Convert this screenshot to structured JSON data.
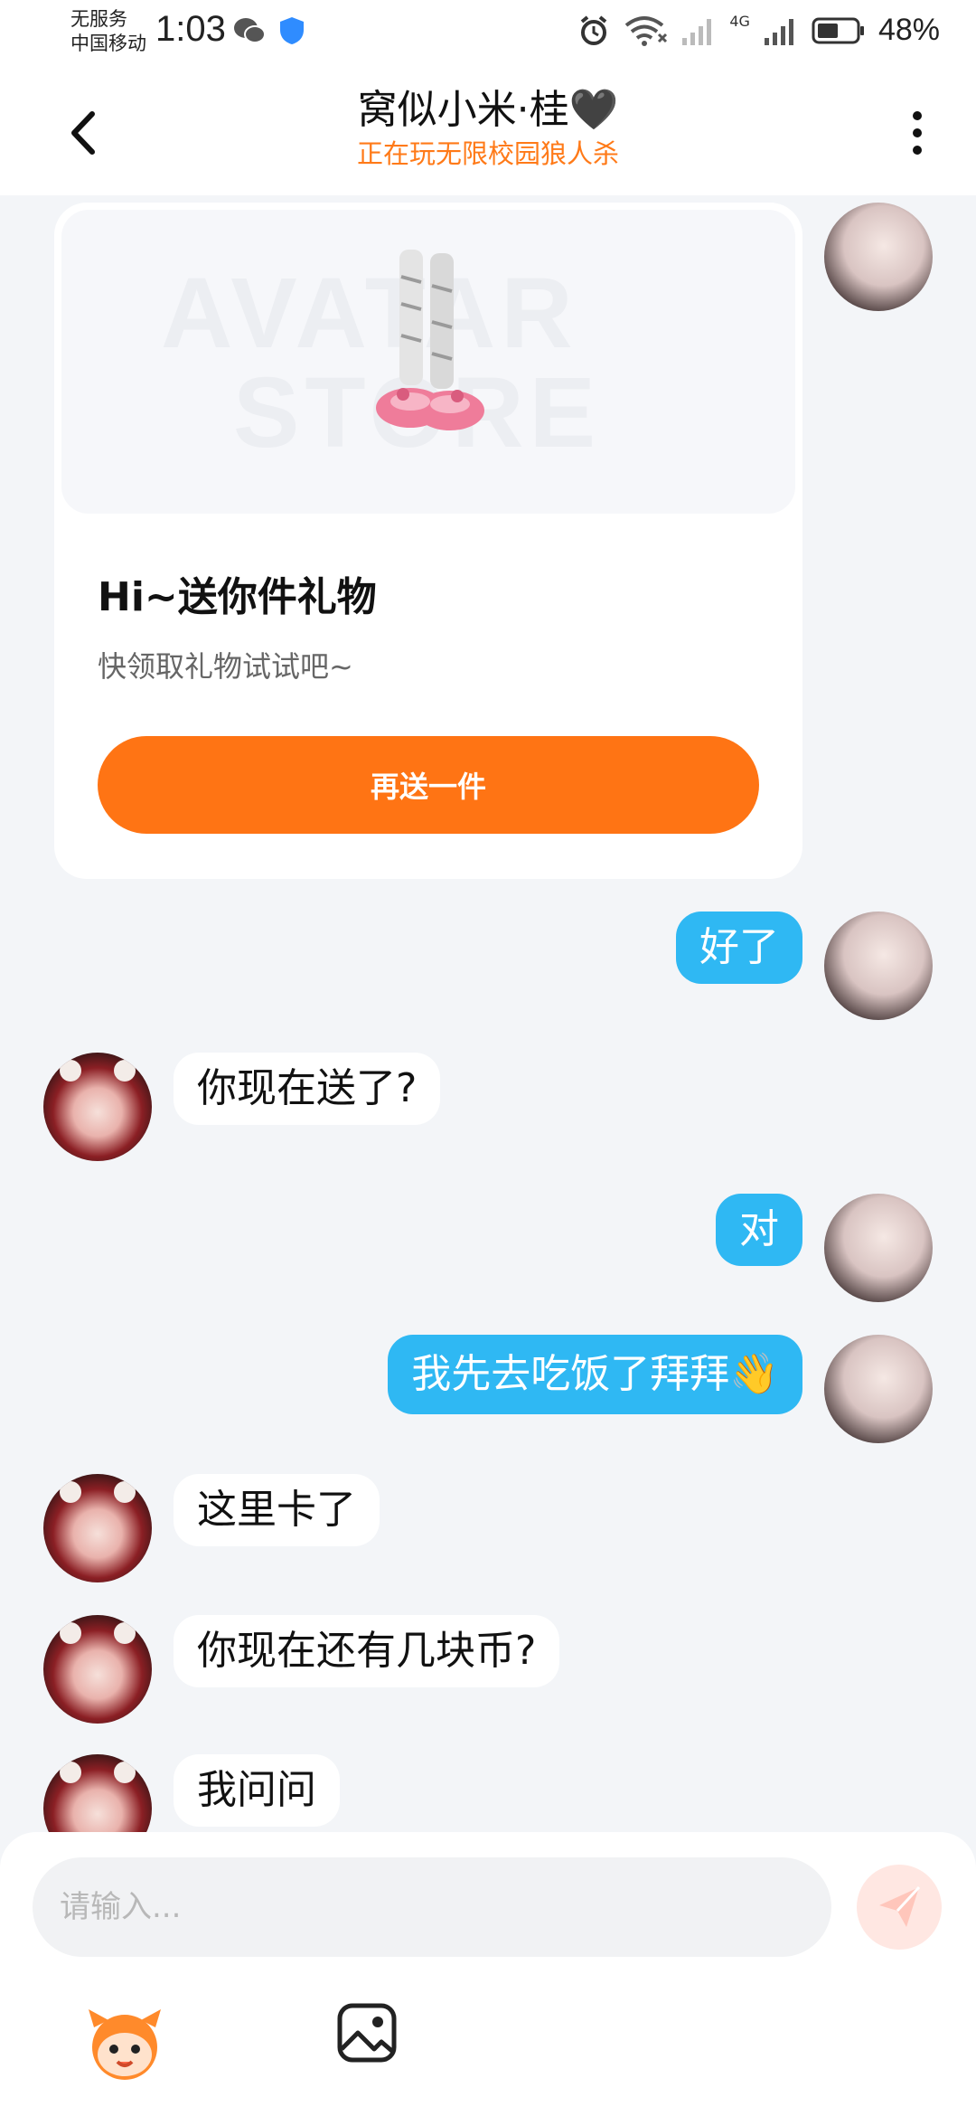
{
  "status_bar": {
    "carrier_line1": "无服务",
    "carrier_line2": "中国移动",
    "time": "1:03",
    "network_label": "4G",
    "battery_percent": "48%",
    "icons": [
      "wechat-icon",
      "shield-icon",
      "alarm-icon",
      "wifi-icon",
      "signal-icon",
      "battery-icon"
    ]
  },
  "header": {
    "title": "窝似小米·桂",
    "title_suffix": "🖤",
    "subtitle": "正在玩无限校园狼人杀"
  },
  "gift_card": {
    "watermark_line1": "AVATAR",
    "watermark_line2": "STORE",
    "title": "Hi~送你件礼物",
    "description": "快领取礼物试试吧~",
    "button_label": "再送一件"
  },
  "messages": [
    {
      "side": "out",
      "text": "好了"
    },
    {
      "side": "in",
      "text": "你现在送了?"
    },
    {
      "side": "out",
      "text": "对"
    },
    {
      "side": "out",
      "text": "我先去吃饭了拜拜👋"
    },
    {
      "side": "in",
      "text": "这里卡了"
    },
    {
      "side": "in",
      "text": "你现在还有几块币?"
    },
    {
      "side": "in",
      "text": "我问问"
    }
  ],
  "composer": {
    "placeholder": "请输入...",
    "value": ""
  },
  "colors": {
    "accent_orange": "#ff7414",
    "outgoing_bubble": "#2fb8f3",
    "subtitle_orange": "#ff7a18"
  }
}
